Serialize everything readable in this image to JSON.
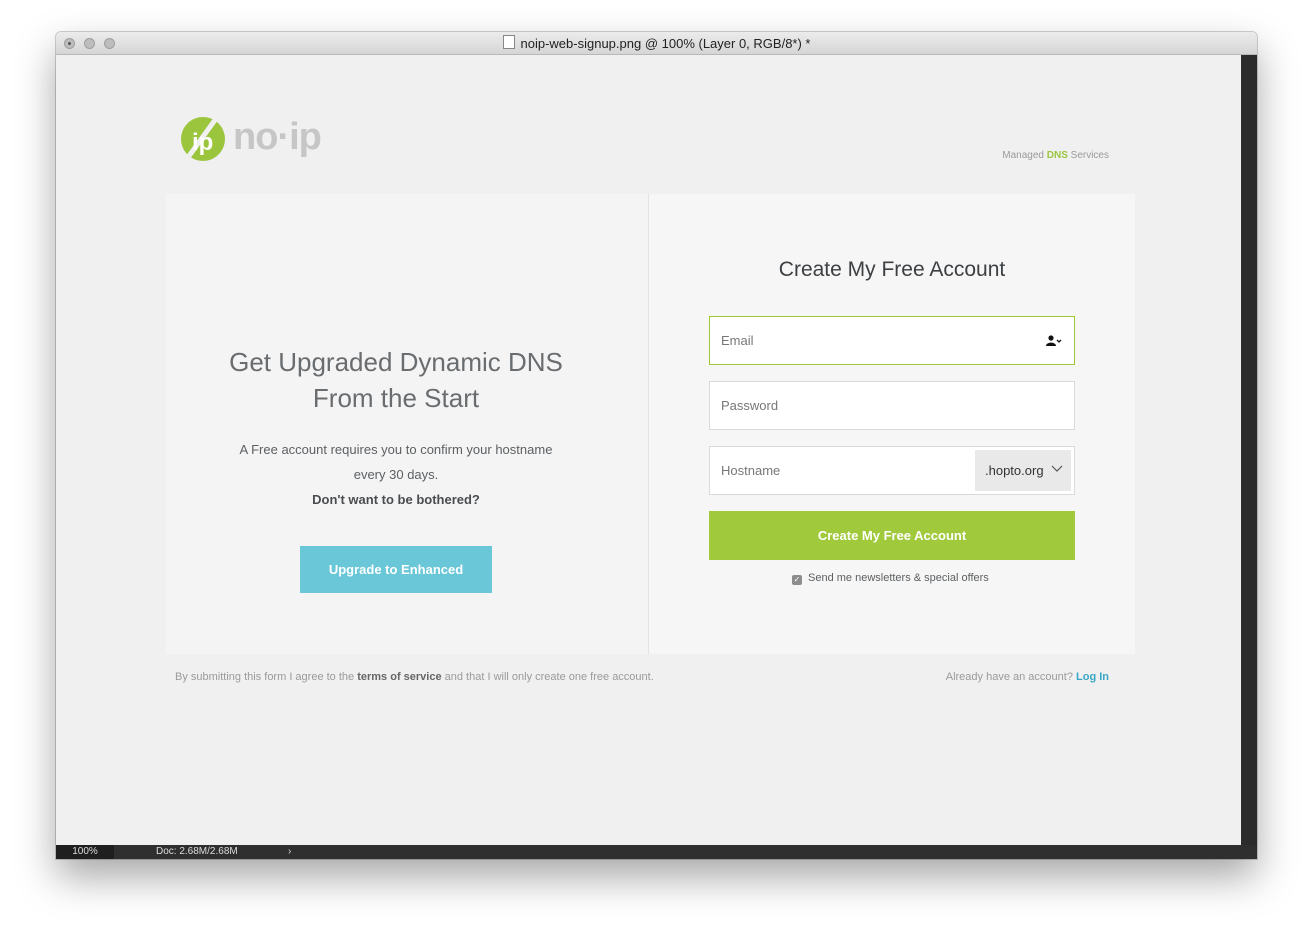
{
  "window": {
    "title": "noip-web-signup.png @ 100% (Layer 0, RGB/8*) *"
  },
  "status": {
    "zoom": "100%",
    "doc": "Doc: 2.68M/2.68M",
    "arrow": "›"
  },
  "header": {
    "logo_text": "no·ip",
    "logo_mark": "ip",
    "tagline_pre": "Managed ",
    "tagline_dns": "DNS",
    "tagline_post": " Services"
  },
  "left": {
    "heading_line1": "Get Upgraded Dynamic DNS",
    "heading_line2": "From the Start",
    "text_line1": "A Free account requires you to confirm your hostname",
    "text_line2": "every 30 days.",
    "text_strong": "Don't want to be bothered?",
    "button": "Upgrade to Enhanced"
  },
  "form": {
    "heading": "Create My Free Account",
    "email_placeholder": "Email",
    "password_placeholder": "Password",
    "hostname_placeholder": "Hostname",
    "domain": ".hopto.org",
    "submit": "Create My Free Account",
    "newsletter": "Send me newsletters & special offers",
    "newsletter_checked": true
  },
  "footer": {
    "left_pre": "By submitting this form I agree to the ",
    "left_link": "terms of service",
    "left_post": " and that I will only create one free account.",
    "right_pre": "Already have an account? ",
    "right_link": "Log In"
  },
  "colors": {
    "accent_green": "#a0ca3c",
    "accent_blue": "#69c7d8",
    "link_blue": "#39a6c5"
  }
}
